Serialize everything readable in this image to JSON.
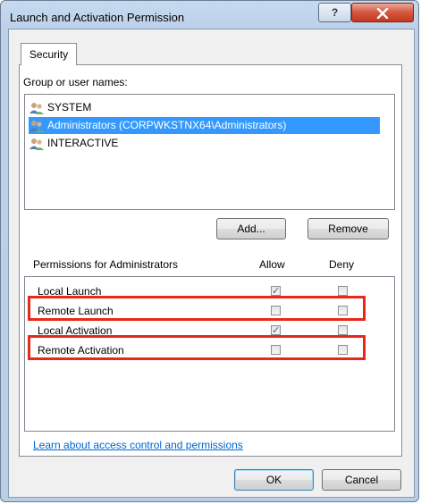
{
  "window": {
    "title": "Launch and Activation Permission"
  },
  "titlebar": {
    "help_label": "?",
    "close_label": "X"
  },
  "tabs": [
    {
      "label": "Security"
    }
  ],
  "users": {
    "label": "Group or user names:",
    "items": [
      {
        "name": "SYSTEM",
        "selected": false
      },
      {
        "name": "Administrators (CORPWKSTNX64\\Administrators)",
        "selected": true
      },
      {
        "name": "INTERACTIVE",
        "selected": false
      }
    ],
    "icon": "users-group-icon"
  },
  "buttons": {
    "add": "Add...",
    "remove": "Remove",
    "ok": "OK",
    "cancel": "Cancel"
  },
  "permissions": {
    "title": "Permissions for Administrators",
    "allow_label": "Allow",
    "deny_label": "Deny",
    "rows": [
      {
        "name": "Local Launch",
        "allow": true,
        "deny": false,
        "highlighted": false
      },
      {
        "name": "Remote Launch",
        "allow": false,
        "deny": false,
        "highlighted": true
      },
      {
        "name": "Local Activation",
        "allow": true,
        "deny": false,
        "highlighted": false
      },
      {
        "name": "Remote Activation",
        "allow": false,
        "deny": false,
        "highlighted": true
      }
    ],
    "highlight_color": "#e8281b"
  },
  "link": {
    "text": "Learn about access control and permissions"
  }
}
